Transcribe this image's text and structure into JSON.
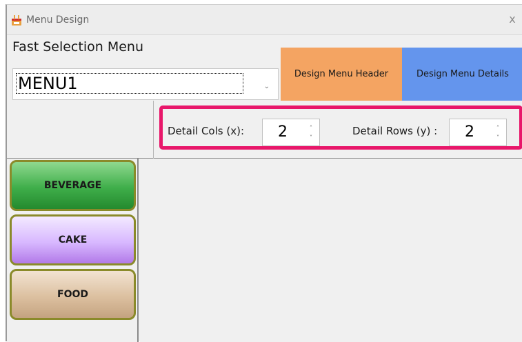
{
  "window": {
    "title": "Menu Design",
    "close_glyph": "x",
    "icon": "menu-design-app-icon"
  },
  "header": {
    "title": "Fast Selection Menu",
    "menu_select": {
      "value": "MENU1",
      "arrow_glyph": "⌄"
    },
    "design_header_label": "Design Menu Header",
    "design_details_label": "Design Menu Details"
  },
  "settings": {
    "cols_label": "Detail Cols (x):",
    "cols_value": "2",
    "rows_label": "Detail Rows (y) :",
    "rows_value": "2",
    "spin_up_glyph": "˄",
    "spin_down_glyph": "˅",
    "highlight_color": "#e8176a"
  },
  "categories": [
    {
      "label": "BEVERAGE",
      "color": "#3fae4a"
    },
    {
      "label": "CAKE",
      "color": "#d8b8ff"
    },
    {
      "label": "FOOD",
      "color": "#dcc0a0"
    }
  ],
  "colors": {
    "design_header_bg": "#f4a462",
    "design_details_bg": "#6495ed"
  }
}
